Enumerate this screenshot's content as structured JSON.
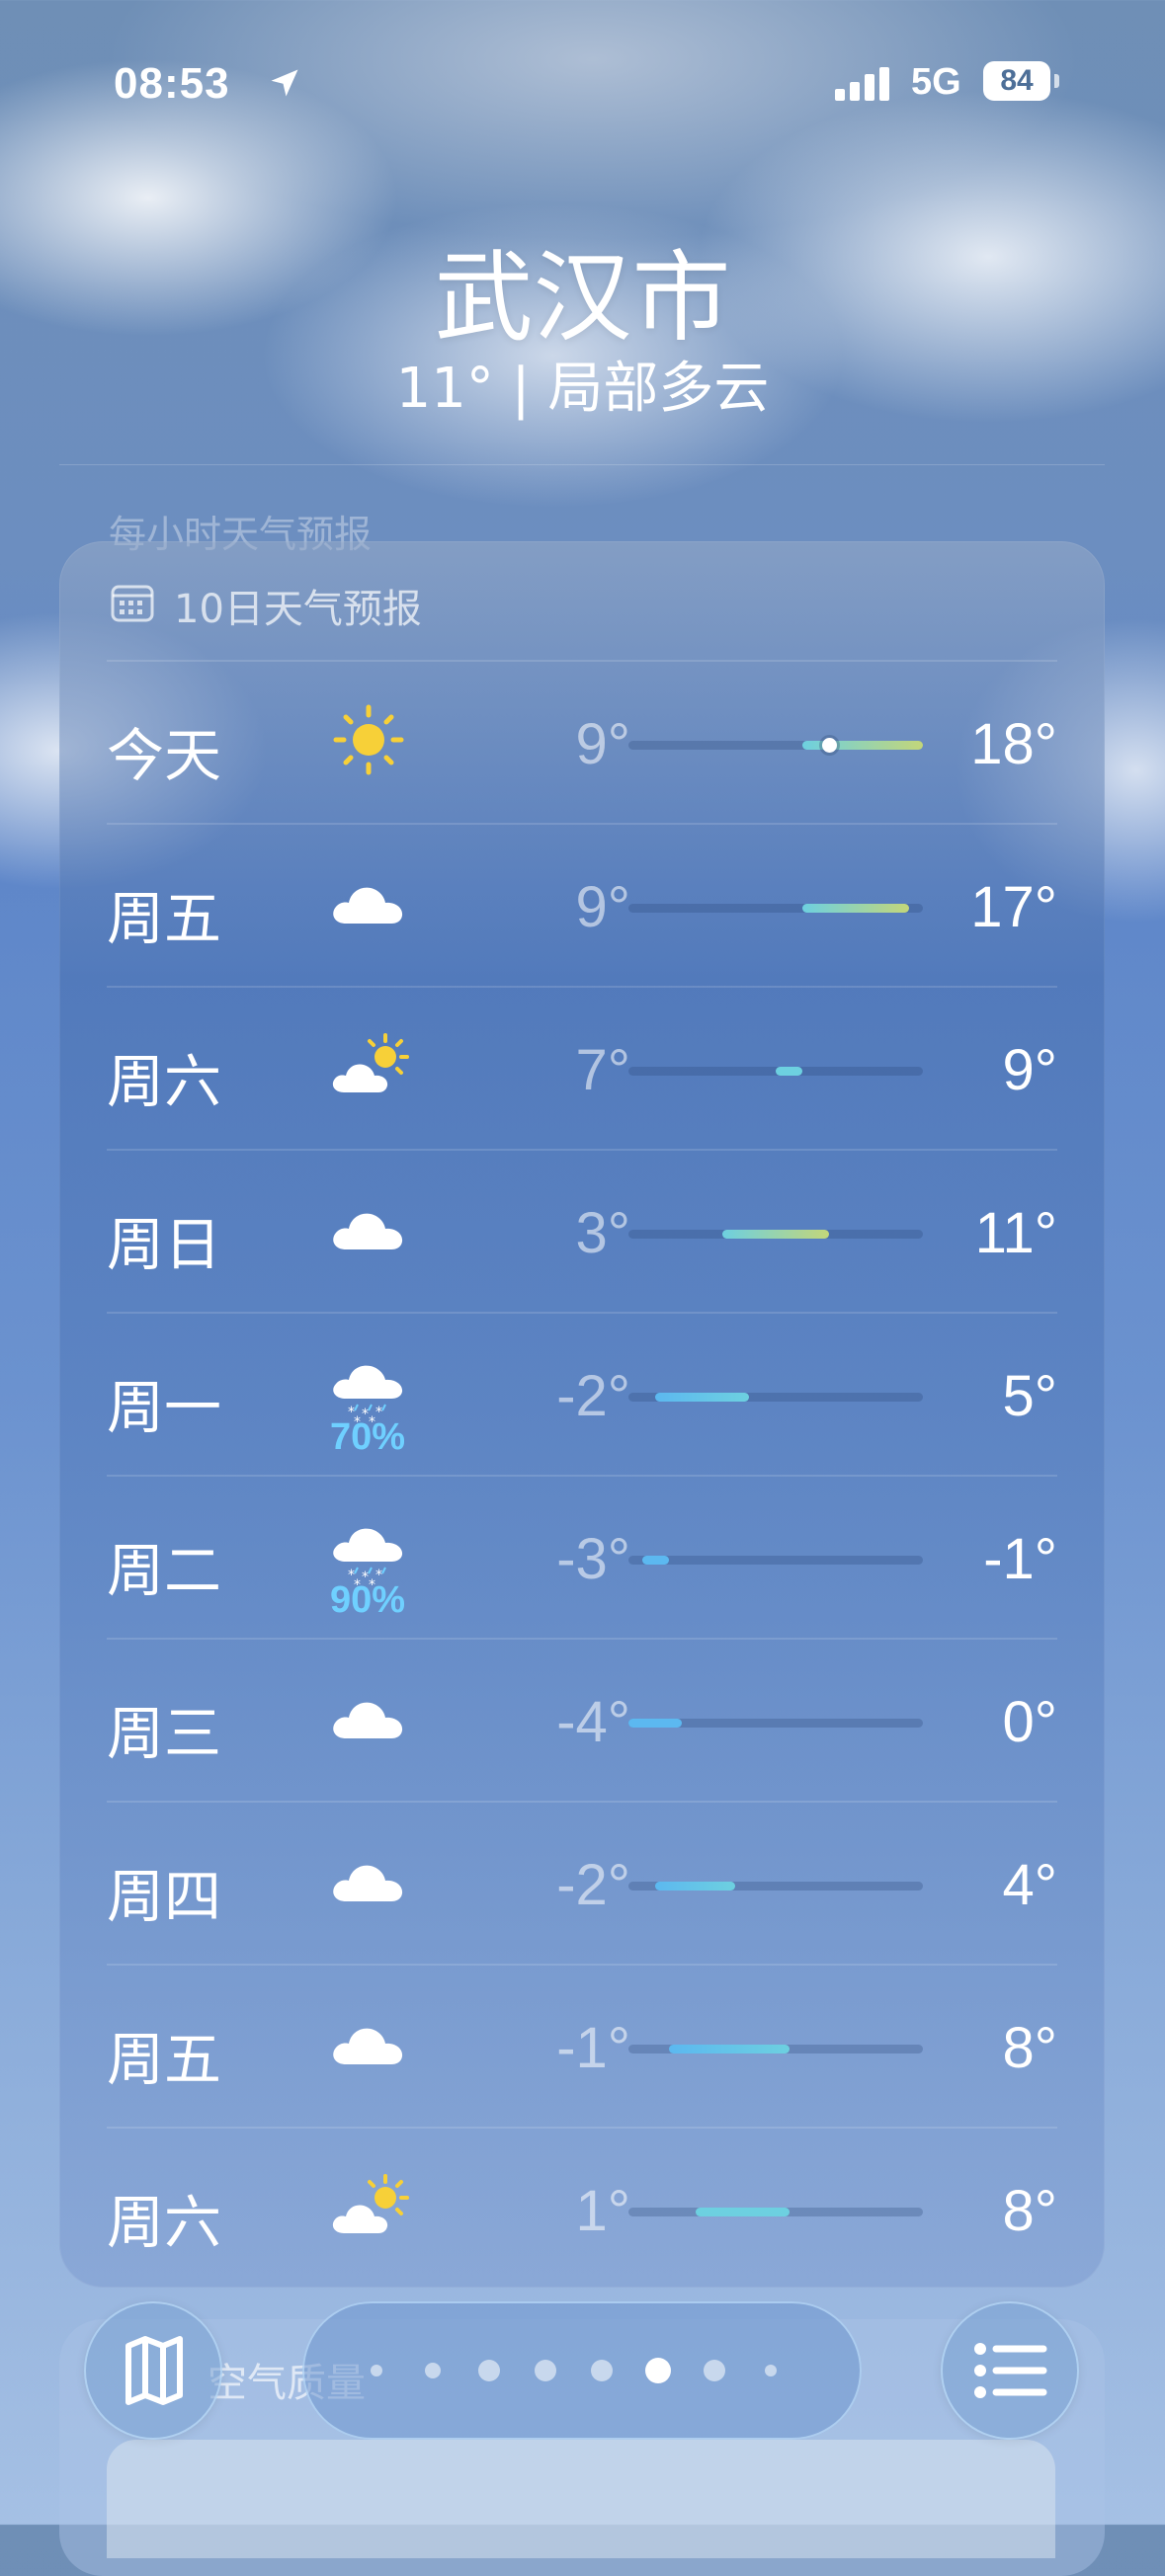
{
  "status": {
    "time": "08:53",
    "network": "5G",
    "battery": "84"
  },
  "header": {
    "city": "武汉市",
    "condition": "11° | 局部多云",
    "hourly_hint": "每小时天气预报"
  },
  "forecast": {
    "title": "10日天气预报",
    "scale": {
      "min": -4,
      "max": 18
    },
    "days": [
      {
        "day": "今天",
        "icon": "sun-icon",
        "low": "9°",
        "high": "18°",
        "low_v": 9,
        "high_v": 18,
        "current_v": 11,
        "precip": ""
      },
      {
        "day": "周五",
        "icon": "cloud-icon",
        "low": "9°",
        "high": "17°",
        "low_v": 9,
        "high_v": 17,
        "precip": ""
      },
      {
        "day": "周六",
        "icon": "partly-sunny-icon",
        "low": "7°",
        "high": "9°",
        "low_v": 7,
        "high_v": 9,
        "precip": ""
      },
      {
        "day": "周日",
        "icon": "cloud-icon",
        "low": "3°",
        "high": "11°",
        "low_v": 3,
        "high_v": 11,
        "precip": ""
      },
      {
        "day": "周一",
        "icon": "snow-cloud-icon",
        "low": "-2°",
        "high": "5°",
        "low_v": -2,
        "high_v": 5,
        "precip": "70%"
      },
      {
        "day": "周二",
        "icon": "snow-cloud-icon",
        "low": "-3°",
        "high": "-1°",
        "low_v": -3,
        "high_v": -1,
        "precip": "90%"
      },
      {
        "day": "周三",
        "icon": "cloud-icon",
        "low": "-4°",
        "high": "0°",
        "low_v": -4,
        "high_v": 0,
        "precip": ""
      },
      {
        "day": "周四",
        "icon": "cloud-icon",
        "low": "-2°",
        "high": "4°",
        "low_v": -2,
        "high_v": 4,
        "precip": ""
      },
      {
        "day": "周五",
        "icon": "cloud-icon",
        "low": "-1°",
        "high": "8°",
        "low_v": -1,
        "high_v": 8,
        "precip": ""
      },
      {
        "day": "周六",
        "icon": "partly-sunny-icon",
        "low": "1°",
        "high": "8°",
        "low_v": 1,
        "high_v": 8,
        "precip": ""
      }
    ]
  },
  "air_quality": {
    "title": "空气质量"
  },
  "pager": {
    "count": 8,
    "active": 5
  },
  "colors": {
    "cold": "#5cb8f0",
    "cool": "#6dd0e0",
    "warm": "#c3d67a",
    "sun": "#f7d038",
    "precip": "#6fd0ff"
  }
}
